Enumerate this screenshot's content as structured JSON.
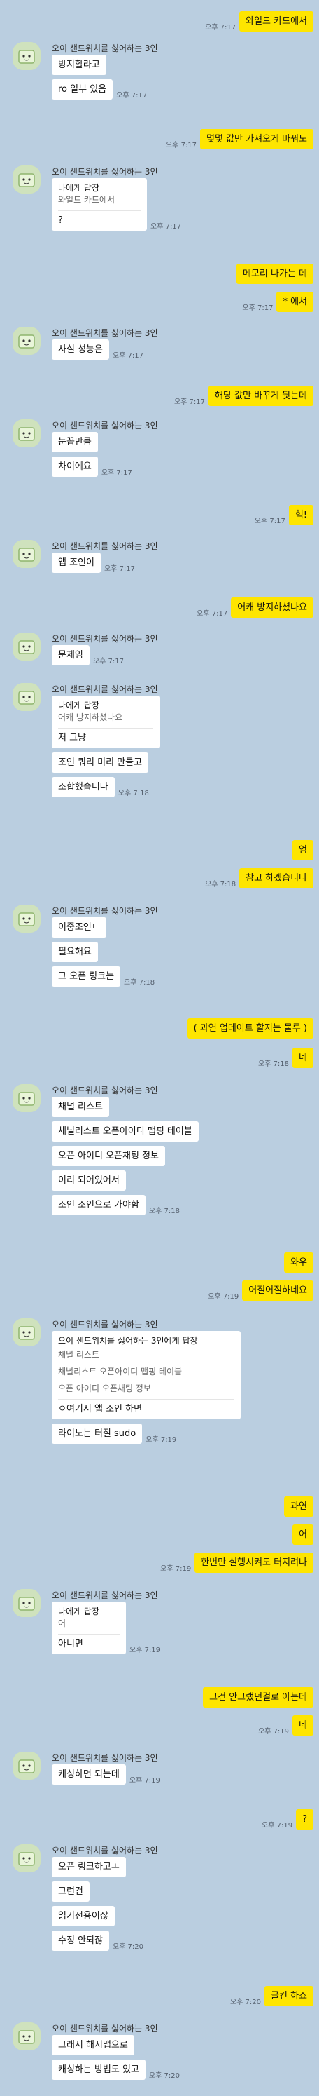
{
  "sender_name": "오이 샌드위치를 싫어하는 3인",
  "reply_header": "나에게 답장",
  "messages": {
    "m1": {
      "text": "와일드 카드에서",
      "time": "오후 7:17"
    },
    "o1": {
      "lines": [
        "방지할라고",
        "ro 일부 있음"
      ],
      "time": "오후 7:17"
    },
    "m2": {
      "text": "몇몇 값만 가져오게 바꿔도",
      "time": "오후 7:17"
    },
    "o2": {
      "reply_quote": "와일드 카드에서",
      "reply_body": "?",
      "time": "오후 7:17"
    },
    "m3": {
      "text": "메모리 나가는 데"
    },
    "m4": {
      "text": "* 에서",
      "time": "오후 7:17"
    },
    "o3": {
      "lines": [
        "사실 성능은"
      ],
      "time": "오후 7:17"
    },
    "m5": {
      "text": "해당 값만 바꾸게 뒷는데",
      "time": "오후 7:17"
    },
    "o4": {
      "lines": [
        "눈꼽만큼",
        "차이에요"
      ],
      "time": "오후 7:17"
    },
    "m6": {
      "text": "헉!",
      "time": "오후 7:17"
    },
    "o5": {
      "lines": [
        "앱 조인이"
      ],
      "time": "오후 7:17"
    },
    "m7": {
      "text": "어캐 방지하셨나요",
      "time": "오후 7:17"
    },
    "o6": {
      "lines": [
        "문제임"
      ],
      "time": "오후 7:17"
    },
    "o7": {
      "reply_quote": "어캐 방지하셨나요",
      "reply_body": "저 그냥",
      "lines": [
        "조인   쿼리 미리 만들고",
        "조합했습니다"
      ],
      "time": "오후 7:18"
    },
    "m8": {
      "text": "엄"
    },
    "m9": {
      "text": "참고 하겠습니다",
      "time": "오후 7:18"
    },
    "o8": {
      "lines": [
        "이중조인ㄴ",
        "필요해요",
        "그 오픈 링크는"
      ],
      "time": "오후 7:18"
    },
    "m10": {
      "text": "( 과연 업데이트 할지는 물루 )"
    },
    "m11": {
      "text": "네",
      "time": "오후 7:18"
    },
    "o9": {
      "lines": [
        "채널 리스트",
        "채널리스트 오픈아이디 맵핑 테이블",
        "오픈 아이디 오픈채팅 정보",
        "이리 되어있어서",
        "조인 조인으로 가야함"
      ],
      "time": "오후 7:18"
    },
    "m12": {
      "text": "와우"
    },
    "m13": {
      "text": "어질어질하네요",
      "time": "오후 7:19"
    },
    "o10": {
      "reply_head": "오이 샌드위치를 싫어하는 3인에게 답장",
      "reply_quote_lines": [
        "채널 리스트",
        "채널리스트 오픈아이디 맵핑 테이블",
        "오픈 아이디 오픈채팅 정보"
      ],
      "reply_body": "ㅇ여기서 앱 조인 하면",
      "lines": [
        "라이노는 터질 sudo"
      ],
      "time": "오후 7:19"
    },
    "m14": {
      "text": "과연"
    },
    "m15": {
      "text": "어"
    },
    "m16": {
      "text": "한번만 실행시켜도 터지려나",
      "time": "오후 7:19"
    },
    "o11": {
      "reply_quote": "어",
      "reply_body": "아니면",
      "time": "오후 7:19"
    },
    "m17": {
      "text": "그건 안그랬던걸로 아는데"
    },
    "m18": {
      "text": "네",
      "time": "오후 7:19"
    },
    "o12": {
      "lines": [
        "캐싱하면 되는데"
      ],
      "time": "오후 7:19"
    },
    "m19": {
      "text": "?",
      "time": "오후 7:19"
    },
    "o13": {
      "lines": [
        "오픈 링크하고ㅗ",
        "그런건",
        "읽기전용이잖",
        "수정 안되잖"
      ],
      "time": "오후 7:20"
    },
    "m20": {
      "text": "글킨 하죠",
      "time": "오후 7:20"
    },
    "o14": {
      "lines": [
        "그래서 해시맵으로",
        "캐싱하는 방법도 있고"
      ],
      "time": "오후 7:20"
    }
  }
}
